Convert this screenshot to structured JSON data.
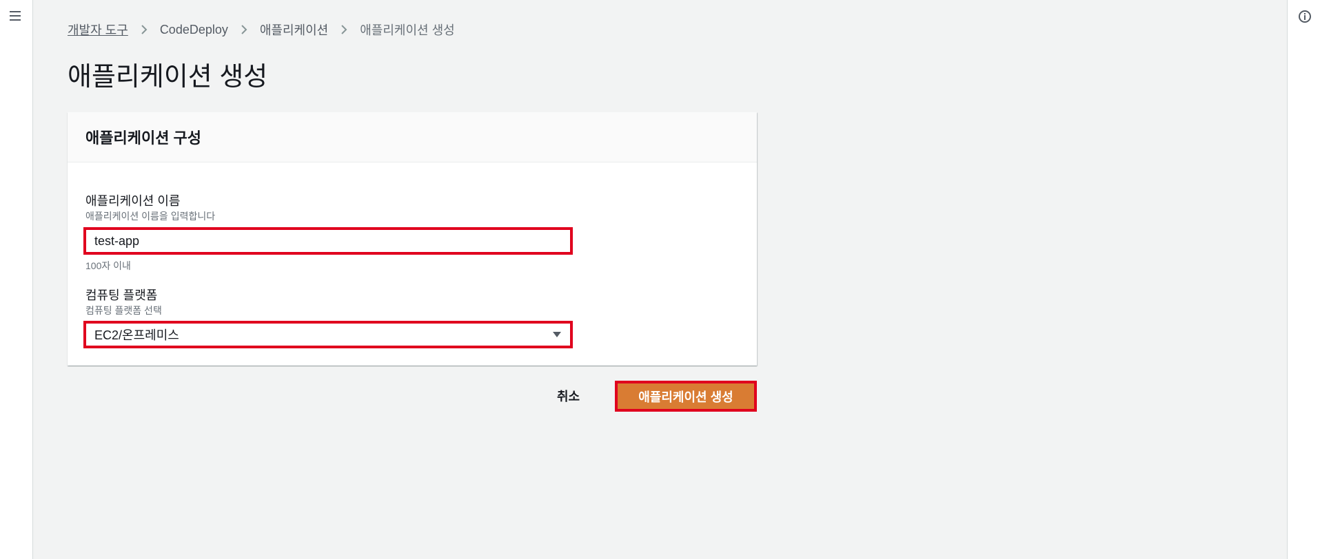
{
  "breadcrumb": {
    "items": [
      "개발자 도구",
      "CodeDeploy",
      "애플리케이션"
    ],
    "current": "애플리케이션 생성"
  },
  "page": {
    "title": "애플리케이션 생성"
  },
  "panel": {
    "header": "애플리케이션 구성",
    "app_name": {
      "label": "애플리케이션 이름",
      "description": "애플리케이션 이름을 입력합니다",
      "value": "test-app",
      "constraint": "100자 이내"
    },
    "platform": {
      "label": "컴퓨팅 플랫폼",
      "description": "컴퓨팅 플랫폼 선택",
      "selected": "EC2/온프레미스"
    }
  },
  "actions": {
    "cancel_label": "취소",
    "create_label": "애플리케이션 생성"
  },
  "icons": {
    "menu": "hamburger-menu-icon",
    "info": "info-icon",
    "separator": "chevron-right-icon",
    "dropdown": "caret-down-icon"
  },
  "colors": {
    "primary_button": "#d97c33",
    "highlight_border": "#e0001e",
    "link": "#545b64",
    "background": "#f2f3f3"
  }
}
